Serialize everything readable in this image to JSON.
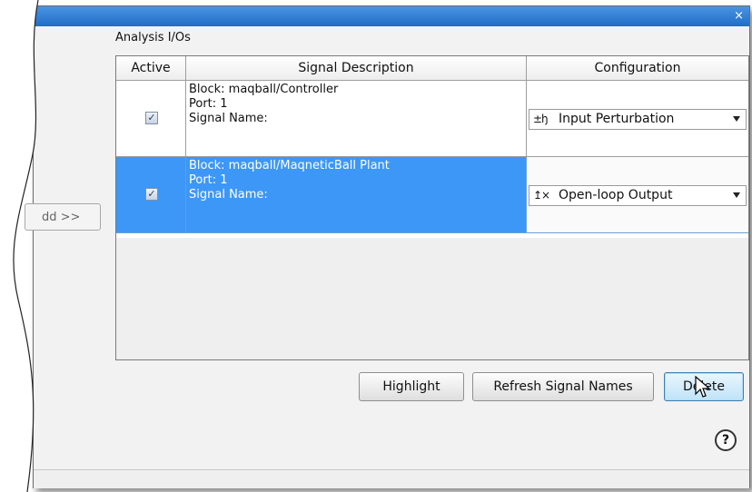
{
  "window": {
    "close_label": "×"
  },
  "section_label": "Analysis I/Os",
  "add_button_label": "dd >>",
  "table": {
    "headers": [
      "Active",
      "Signal Description",
      "Configuration"
    ],
    "rows": [
      {
        "active": true,
        "selected": false,
        "block": "Block: maqball/Controller",
        "port": "Port: 1",
        "signal_name": "Signal Name:",
        "config_icon": "input-perturbation-icon",
        "config_icon_glyph": "±ꜧ",
        "config": "Input Perturbation"
      },
      {
        "active": true,
        "selected": true,
        "block": "Block: maqball/MaqneticBall Plant",
        "port": "Port: 1",
        "signal_name": "Signal Name:",
        "config_icon": "open-loop-output-icon",
        "config_icon_glyph": "↥×",
        "config": "Open-loop Output"
      }
    ]
  },
  "buttons": {
    "highlight": "Highlight",
    "refresh": "Refresh Signal Names",
    "delete": "Delete"
  },
  "help_label": "?",
  "colors": {
    "selection": "#3d97f7",
    "titlebar": "#2b7bd6"
  }
}
